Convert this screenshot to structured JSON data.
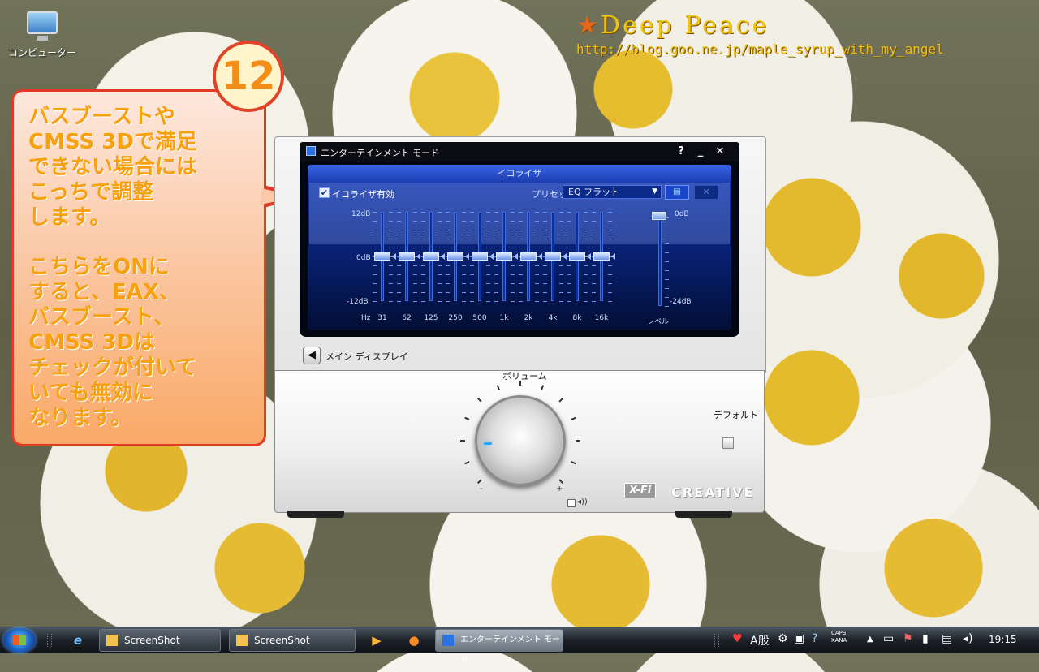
{
  "desktop": {
    "icon_label": "コンピューター"
  },
  "watermark": {
    "title": "Deep Peace",
    "url": "http://blog.goo.ne.jp/maple_syrup_with_my_angel"
  },
  "annotation": {
    "number": "12",
    "paragraph1": "バスブーストや\nCMSS 3Dで満足\nできない場合には\nこっちで調整\nします。",
    "paragraph2": "こちらをONに\nすると、EAX、\nバスブースト、\nCMSS 3Dは\nチェックが付いて\nいても無効に\nなります。"
  },
  "window": {
    "title": "エンターテインメント モード",
    "help": "?",
    "minimize": "_",
    "close": "✕"
  },
  "equalizer": {
    "header": "イコライザ",
    "enable_label": "イコライザ有効",
    "enabled": true,
    "preset_label": "プリセット",
    "preset_value": "EQ フラット",
    "db_top": "12dB",
    "db_mid": "0dB",
    "db_bottom": "-12dB",
    "hz_label": "Hz",
    "bands": [
      {
        "freq": "31",
        "gain_db": 0
      },
      {
        "freq": "62",
        "gain_db": 0
      },
      {
        "freq": "125",
        "gain_db": 0
      },
      {
        "freq": "250",
        "gain_db": 0
      },
      {
        "freq": "500",
        "gain_db": 0
      },
      {
        "freq": "1k",
        "gain_db": 0
      },
      {
        "freq": "2k",
        "gain_db": 0
      },
      {
        "freq": "4k",
        "gain_db": 0
      },
      {
        "freq": "8k",
        "gain_db": 0
      },
      {
        "freq": "16k",
        "gain_db": 0
      }
    ],
    "level_top": "0dB",
    "level_bottom": "-24dB",
    "level_label": "レベル",
    "level_db": 0
  },
  "navigation": {
    "back_label": "メイン ディスプレイ"
  },
  "volume": {
    "label": "ボリューム",
    "minus": "-",
    "plus": "+",
    "default_label": "デフォルト"
  },
  "branding": {
    "xfi": "X-Fi",
    "creative": "CREATIVE"
  },
  "taskbar": {
    "buttons": [
      {
        "label": "ScreenShot"
      },
      {
        "label": "ScreenShot"
      },
      {
        "label": "エンターテインメント モード"
      }
    ],
    "ime": "A般",
    "caps": "CAPS",
    "kana": "KANA",
    "clock": "19:15"
  }
}
